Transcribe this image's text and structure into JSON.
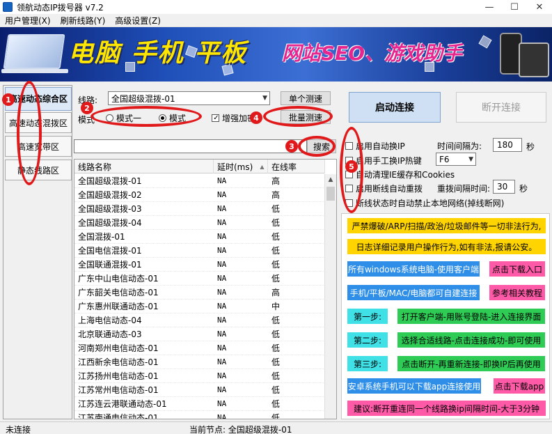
{
  "window": {
    "title": "领航动态IP拨号器 v7.2",
    "minimize": "—",
    "maximize": "☐",
    "close": "✕"
  },
  "menu": [
    "用户管理(X)",
    "刷新线路(Y)",
    "高级设置(Z)"
  ],
  "banner": {
    "main": "电脑 手机 平板",
    "sub": "网站SEO、游戏助手"
  },
  "leftnav": [
    "高速动态综合区",
    "高速动态混拨区",
    "高速宽带区",
    "静态线路区"
  ],
  "line": {
    "label": "线路:",
    "selected": "全国超级混拨-01",
    "single_test": "单个测速",
    "mode_label": "模式",
    "mode1": "模式一",
    "mode2": "模式",
    "enhance": "增强加密",
    "batch_test": "批量测速",
    "search": "搜索"
  },
  "table": {
    "headers": [
      "线路名称",
      "延时(ms)",
      "在线率"
    ],
    "sort_icon": "▲",
    "rows": [
      [
        "全国超级混拨-01",
        "NA",
        "高"
      ],
      [
        "全国超级混拨-02",
        "NA",
        "高"
      ],
      [
        "全国超级混拨-03",
        "NA",
        "低"
      ],
      [
        "全国超级混拨-04",
        "NA",
        "低"
      ],
      [
        "全国混拨-01",
        "NA",
        "低"
      ],
      [
        "全国电信混拨-01",
        "NA",
        "低"
      ],
      [
        "全国联通混拨-01",
        "NA",
        "低"
      ],
      [
        "广东中山电信动态-01",
        "NA",
        "低"
      ],
      [
        "广东韶关电信动态-01",
        "NA",
        "高"
      ],
      [
        "广东惠州联通动态-01",
        "NA",
        "中"
      ],
      [
        "上海电信动态-04",
        "NA",
        "低"
      ],
      [
        "北京联通动态-03",
        "NA",
        "低"
      ],
      [
        "河南郑州电信动态-01",
        "NA",
        "低"
      ],
      [
        "江西新余电信动态-01",
        "NA",
        "低"
      ],
      [
        "江苏扬州电信动态-01",
        "NA",
        "低"
      ],
      [
        "江苏常州电信动态-01",
        "NA",
        "低"
      ],
      [
        "江苏连云港联通动态-01",
        "NA",
        "低"
      ],
      [
        "江苏南通电信动态-01",
        "NA",
        "低"
      ]
    ]
  },
  "connect": {
    "start": "启动连接",
    "stop": "断开连接"
  },
  "options": {
    "auto_switch": "启用自动换IP",
    "interval_label": "时间间隔为:",
    "interval_value": "180",
    "sec": "秒",
    "hotkey": "启用手工换IP热键",
    "hotkey_value": "F6",
    "clear_ie": "自动清理IE缓存和Cookies",
    "auto_redial": "启用断线自动重拨",
    "redial_label": "重拨间隔时间:",
    "redial_value": "30",
    "sec2": "秒",
    "disable_net": "断线状态时自动禁止本地网络(掉线断网)"
  },
  "notices": {
    "n1": "严禁爆破/ARP/扫描/政治/垃圾邮件等一切非法行为,",
    "n2": "日志详细记录用户操作行为,如有非法,报请公安。",
    "n3": "所有windows系统电脑-使用客户端",
    "n3b": "点击下载入口",
    "n4": "手机/平板/MAC/电脑都可自建连接",
    "n4b": "参考相关教程",
    "s1": "第一步:",
    "s1t": "打开客户端-用账号登陆-进入连接界面",
    "s2": "第二步:",
    "s2t": "选择合适线路-点击连接成功-即可使用",
    "s3": "第三步:",
    "s3t": "点击断开-再重新连接-即换IP后再使用",
    "android": "安卓系统手机可以下载app连接使用",
    "androidb": "点击下载app",
    "tip": "建议:断开重连同一个线路换ip间隔时间-大于3分钟"
  },
  "status": {
    "left": "未连接",
    "node": "当前节点: 全国超级混拨-01"
  },
  "annotations": [
    "1",
    "2",
    "3",
    "4",
    "5"
  ],
  "colors": {
    "yellow": "#ffd400",
    "blue": "#2f8fe8",
    "pink": "#ff5aa8",
    "green": "#2ecc55",
    "cyan": "#3fe0e6",
    "red": "#e0191b"
  }
}
